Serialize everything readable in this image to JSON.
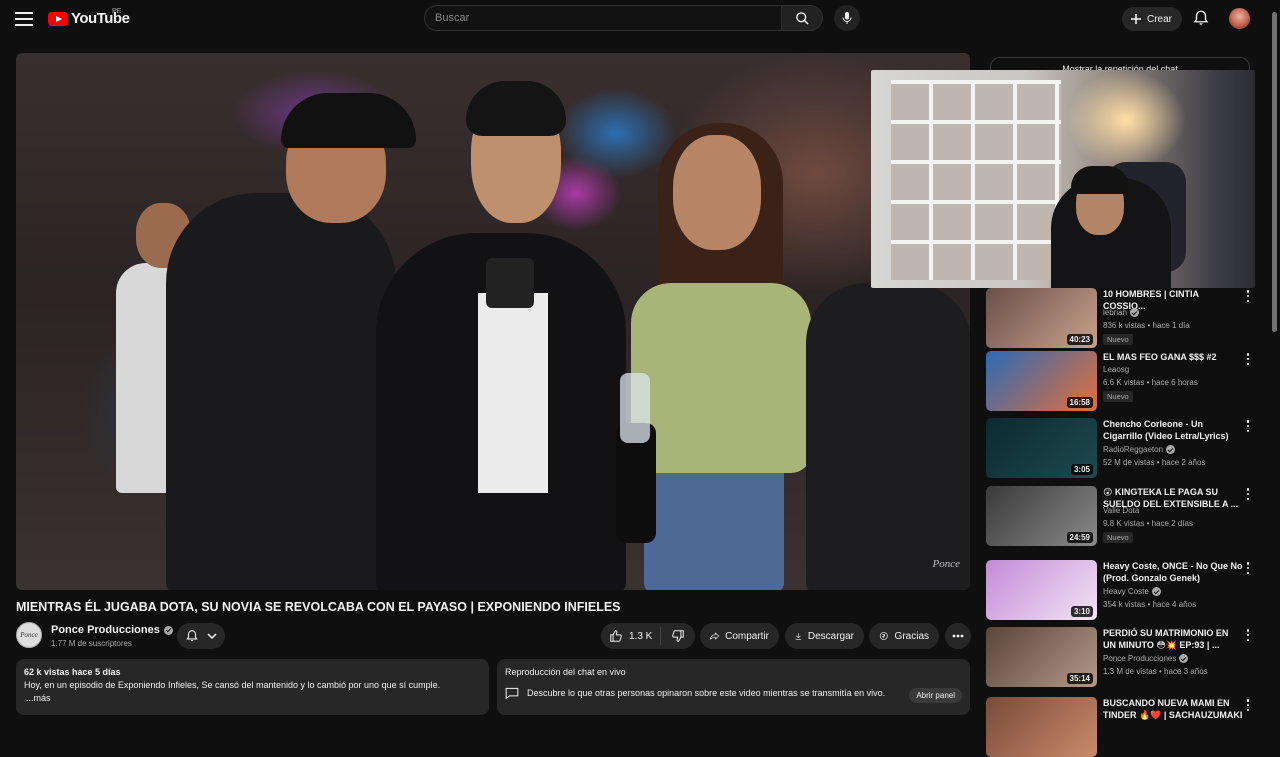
{
  "header": {
    "logo_text": "YouTube",
    "country_code": "PE",
    "search_placeholder": "Buscar",
    "create_label": "Crear"
  },
  "player": {
    "watermark": "Ponce"
  },
  "chat_replay": {
    "label": "Mostrar la repetición del chat"
  },
  "video": {
    "title": "MIENTRAS ÉL JUGABA DOTA, SU NOVIA SE REVOLCABA CON EL PAYASO | EXPONIENDO INFIELES",
    "channel_name": "Ponce Producciones",
    "channel_avatar_text": "Ponce",
    "subscribers": "1.77 M de suscriptores",
    "likes": "1.3 K",
    "share_label": "Compartir",
    "download_label": "Descargar",
    "thanks_label": "Gracias"
  },
  "description": {
    "views_date": "62 k vistas  hace 5 días",
    "text": "Hoy, en un episodio  de Exponiendo Infieles, Se cansó del mantenido y lo cambió por uno que sí cumple.",
    "more": "...más"
  },
  "live_chat": {
    "title": "Reproducción del chat en vivo",
    "text": "Descubre lo que otras personas opinaron sobre este video mientras se transmitía en vivo.",
    "open_label": "Abrir panel"
  },
  "recommendations": [
    {
      "title": "10 HOMBRES | CINTIA COSSIO...",
      "channel": "lebriah",
      "meta": "836 k vistas • hace 1 día",
      "badge": "Nuevo",
      "duration": "40:23",
      "colors": [
        "#6a4f4a",
        "#c9a28c"
      ]
    },
    {
      "title": "EL MAS FEO GANA $$$ #2",
      "channel": "Leaosg",
      "meta": "6.6 K vistas • hace 6 horas",
      "badge": "Nuevo",
      "duration": "16:58",
      "colors": [
        "#2a6bb8",
        "#e46f3a"
      ]
    },
    {
      "title": "Chencho Corleone - Un Cigarrillo (Video Letra/Lyrics)",
      "channel": "RadioReggaeton",
      "meta": "52 M de vistas • hace 2 años",
      "badge": "",
      "duration": "3:05",
      "colors": [
        "#0b2a2e",
        "#1d4a50"
      ]
    },
    {
      "title": "😲 KINGTEKA LE PAGA SU SUELDO DEL EXTENSIBLE A ...",
      "channel": "Valle Dota",
      "meta": "9.8 K vistas • hace 2 días",
      "badge": "Nuevo",
      "duration": "24:59",
      "colors": [
        "#3a3a3a",
        "#8a8a8a"
      ]
    },
    {
      "title": "Heavy Coste, ONCE - No Que No (Prod. Gonzalo Genek)",
      "channel": "Heavy Coste",
      "meta": "354 k vistas • hace 4 años",
      "badge": "",
      "duration": "3:10",
      "colors": [
        "#c48ad8",
        "#f2e4f4"
      ]
    },
    {
      "title": "PERDIÓ SU MATRIMONIO EN UN MINUTO 😳💥 EP:93 | ...",
      "channel": "Ponce Producciones",
      "meta": "1.3 M de vistas • hace 3 años",
      "badge": "",
      "duration": "35:14",
      "colors": [
        "#5a4538",
        "#b3998a"
      ]
    },
    {
      "title": "BUSCANDO NUEVA MAMI EN TINDER 🔥❤️ | SACHAUZUMAKI",
      "channel": "",
      "meta": "",
      "badge": "",
      "duration": "",
      "colors": [
        "#7a4a3a",
        "#c98a6a"
      ]
    }
  ]
}
